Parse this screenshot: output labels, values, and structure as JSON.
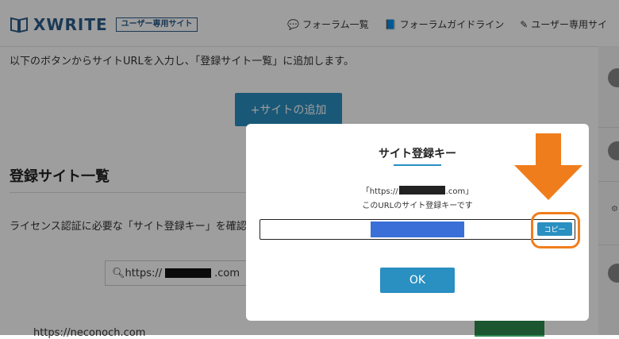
{
  "header": {
    "logo_text": "XWRITE",
    "logo_badge": "ユーザー専用サイト",
    "nav": [
      {
        "icon": "forum-icon",
        "glyph": "💬",
        "label": "フォーラム一覧"
      },
      {
        "icon": "guide-book-icon",
        "glyph": "📘",
        "label": "フォーラムガイドライン"
      },
      {
        "icon": "pencil-icon",
        "glyph": "✎",
        "label": "ユーザー専用サイ"
      }
    ]
  },
  "main": {
    "intro": "以下のボタンからサイトURLを入力し、「登録サイト一覧」に追加します。",
    "add_button": "+サイトの追加",
    "section_title": "登録サイト一覧",
    "description": "ライセンス認証に必要な「サイト登録キー」を確認",
    "search_prefix": "https://",
    "search_suffix": ".com",
    "list_url": "https://neconoch.com"
  },
  "modal": {
    "title": "サイト登録キー",
    "url_prefix": "「https://",
    "url_suffix": ".com」",
    "note": "このURLのサイト登録キーです",
    "copy_label": "コピー",
    "ok_label": "OK"
  },
  "colors": {
    "accent": "#2a8fc1",
    "annotation": "#f07d1c",
    "key_highlight": "#3a6fd8"
  }
}
